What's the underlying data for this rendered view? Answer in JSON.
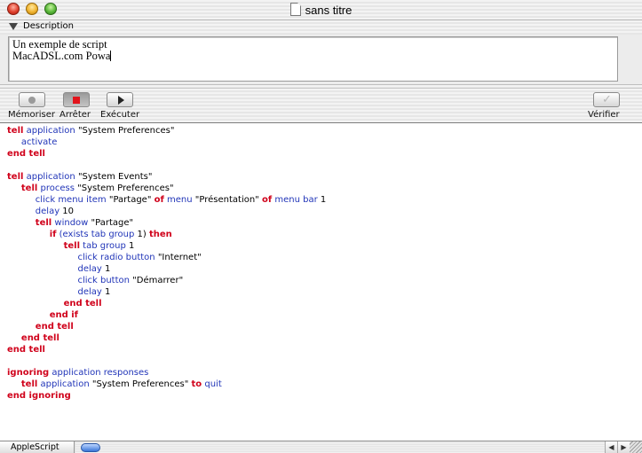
{
  "window": {
    "title": "sans titre"
  },
  "description": {
    "header_label": "Description",
    "lines": [
      "Un exemple de script",
      "MacADSL.com Powa"
    ]
  },
  "toolbar": {
    "record_label": "Mémoriser",
    "stop_label": "Arrêter",
    "run_label": "Exécuter",
    "check_label": "Vérifier"
  },
  "code": [
    [
      [
        "kw",
        "tell"
      ],
      [
        "id",
        " application"
      ],
      [
        "str",
        " \"System Preferences\""
      ]
    ],
    [
      [
        "str",
        "     "
      ],
      [
        "id",
        "activate"
      ]
    ],
    [
      [
        "kw",
        "end tell"
      ]
    ],
    [],
    [
      [
        "kw",
        "tell"
      ],
      [
        "id",
        " application"
      ],
      [
        "str",
        " \"System Events\""
      ]
    ],
    [
      [
        "str",
        "     "
      ],
      [
        "kw",
        "tell"
      ],
      [
        "id",
        " process"
      ],
      [
        "str",
        " \"System Preferences\""
      ]
    ],
    [
      [
        "str",
        "          "
      ],
      [
        "id",
        "click menu item"
      ],
      [
        "str",
        " \"Partage\" "
      ],
      [
        "kw",
        "of"
      ],
      [
        "id",
        " menu"
      ],
      [
        "str",
        " \"Présentation\" "
      ],
      [
        "kw",
        "of"
      ],
      [
        "id",
        " menu bar"
      ],
      [
        "str",
        " 1"
      ]
    ],
    [
      [
        "str",
        "          "
      ],
      [
        "id",
        "delay"
      ],
      [
        "str",
        " 10"
      ]
    ],
    [
      [
        "str",
        "          "
      ],
      [
        "kw",
        "tell"
      ],
      [
        "id",
        " window"
      ],
      [
        "str",
        " \"Partage\""
      ]
    ],
    [
      [
        "str",
        "               "
      ],
      [
        "kw",
        "if"
      ],
      [
        "id",
        " (exists tab group"
      ],
      [
        "str",
        " 1) "
      ],
      [
        "kw",
        "then"
      ]
    ],
    [
      [
        "str",
        "                    "
      ],
      [
        "kw",
        "tell"
      ],
      [
        "id",
        " tab group"
      ],
      [
        "str",
        " 1"
      ]
    ],
    [
      [
        "str",
        "                         "
      ],
      [
        "id",
        "click radio button"
      ],
      [
        "str",
        " \"Internet\""
      ]
    ],
    [
      [
        "str",
        "                         "
      ],
      [
        "id",
        "delay"
      ],
      [
        "str",
        " 1"
      ]
    ],
    [
      [
        "str",
        "                         "
      ],
      [
        "id",
        "click button"
      ],
      [
        "str",
        " \"Démarrer\""
      ]
    ],
    [
      [
        "str",
        "                         "
      ],
      [
        "id",
        "delay"
      ],
      [
        "str",
        " 1"
      ]
    ],
    [
      [
        "str",
        "                    "
      ],
      [
        "kw",
        "end tell"
      ]
    ],
    [
      [
        "str",
        "               "
      ],
      [
        "kw",
        "end if"
      ]
    ],
    [
      [
        "str",
        "          "
      ],
      [
        "kw",
        "end tell"
      ]
    ],
    [
      [
        "str",
        "     "
      ],
      [
        "kw",
        "end tell"
      ]
    ],
    [
      [
        "kw",
        "end tell"
      ]
    ],
    [],
    [
      [
        "kw",
        "ignoring"
      ],
      [
        "id",
        " application responses"
      ]
    ],
    [
      [
        "str",
        "     "
      ],
      [
        "kw",
        "tell"
      ],
      [
        "id",
        " application"
      ],
      [
        "str",
        " \"System Preferences\" "
      ],
      [
        "kw",
        "to"
      ],
      [
        "id",
        " quit"
      ]
    ],
    [
      [
        "kw",
        "end ignoring"
      ]
    ]
  ],
  "statusbar": {
    "language": "AppleScript"
  },
  "colors": {
    "keyword": "#d0021b",
    "identifier": "#2135b8",
    "plain": "#000000"
  }
}
